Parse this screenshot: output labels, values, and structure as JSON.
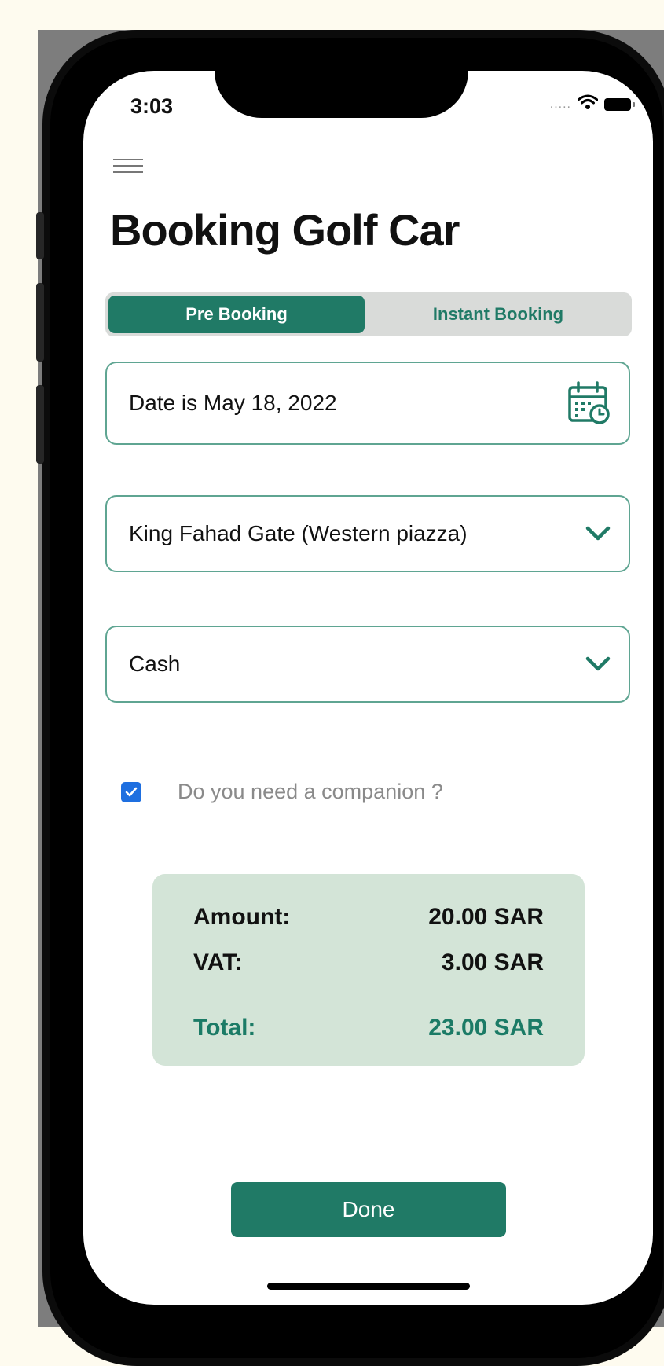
{
  "status_bar": {
    "time": "3:03",
    "signal": "....."
  },
  "header": {
    "title": "Booking Golf Car"
  },
  "tabs": [
    {
      "label": "Pre Booking",
      "active": true
    },
    {
      "label": "Instant Booking",
      "active": false
    }
  ],
  "form": {
    "date_value": "Date is May 18, 2022",
    "location_value": "King Fahad Gate (Western piazza)",
    "payment_value": "Cash",
    "companion": {
      "label": "Do you need a companion ?",
      "checked": true
    }
  },
  "summary": {
    "amount_label": "Amount:",
    "amount_value": "20.00 SAR",
    "vat_label": "VAT:",
    "vat_value": "3.00 SAR",
    "total_label": "Total:",
    "total_value": "23.00 SAR"
  },
  "actions": {
    "done_label": "Done"
  },
  "icons": {
    "menu": "hamburger-menu-icon",
    "calendar": "calendar-clock-icon",
    "dropdown": "chevron-down-icon",
    "check": "checkmark-icon"
  },
  "colors": {
    "brand_green": "#207a66",
    "field_border": "#5fa592",
    "summary_bg": "#d3e4d7",
    "checkbox_blue": "#1e6fe0",
    "page_bg": "#fefbef"
  }
}
